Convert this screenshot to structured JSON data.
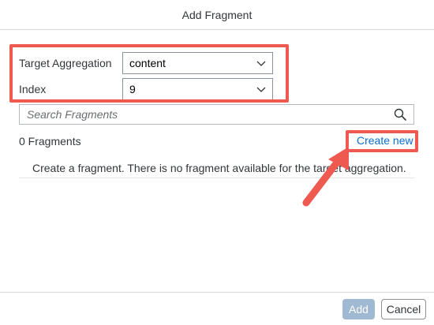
{
  "dialog": {
    "title": "Add Fragment"
  },
  "form": {
    "aggregation_label": "Target Aggregation",
    "aggregation_value": "content",
    "index_label": "Index",
    "index_value": "9"
  },
  "search": {
    "placeholder": "Search Fragments"
  },
  "fragments": {
    "count_label": "0 Fragments",
    "create_new_label": "Create new",
    "empty_message": "Create a fragment. There is no fragment available for the target aggregation."
  },
  "footer": {
    "add_label": "Add",
    "cancel_label": "Cancel"
  },
  "annotation": {
    "highlight_color": "#ef5a50",
    "link_color": "#0a6ed1"
  },
  "icons": {
    "dropdown": "chevron-down-icon",
    "search": "search-icon",
    "pointer": "arrow-annotation"
  }
}
